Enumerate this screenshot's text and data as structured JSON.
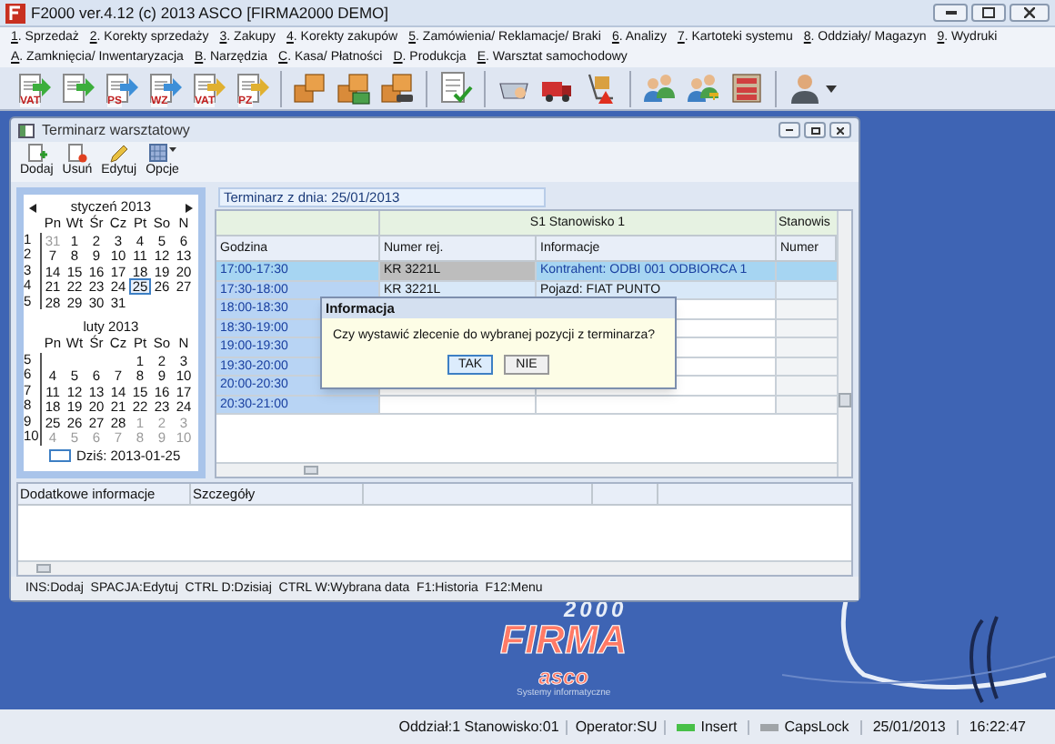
{
  "window": {
    "title": "F2000  ver.4.12 (c) 2013 ASCO  [FIRMA2000 DEMO]"
  },
  "menu": [
    {
      "items": [
        "1. Sprzedaż",
        "2. Korekty sprzedaży",
        "3. Zakupy",
        "4. Korekty zakupów",
        "5. Zamówienia/ Reklamacje/ Braki",
        "6. Analizy",
        "7. Kartoteki systemu",
        "8. Oddziały/ Magazyn",
        "9. Wydruki"
      ]
    },
    {
      "items": [
        "A. Zamknięcia/ Inwentaryzacja",
        "B. Narzędzia",
        "C. Kasa/ Płatności",
        "D. Produkcja",
        "E. Warsztat samochodowy"
      ]
    }
  ],
  "toolbar": [
    {
      "kind": "doc",
      "label": "VAT",
      "color": "#3cae3c"
    },
    {
      "kind": "doc",
      "color": "#3cae3c"
    },
    {
      "kind": "doc",
      "label": "PS",
      "color": "#3d8fd8"
    },
    {
      "kind": "doc",
      "label": "WZ",
      "color": "#3d8fd8"
    },
    {
      "kind": "doc",
      "label": "VAT",
      "color": "#e0b030"
    },
    {
      "kind": "doc",
      "label": "PZ",
      "color": "#e0b030"
    },
    {
      "kind": "separator"
    },
    {
      "kind": "boxes"
    },
    {
      "kind": "boxes-stack"
    },
    {
      "kind": "boxes-car"
    },
    {
      "kind": "separator"
    },
    {
      "kind": "check-doc"
    },
    {
      "kind": "separator"
    },
    {
      "kind": "basket"
    },
    {
      "kind": "truck"
    },
    {
      "kind": "cart"
    },
    {
      "kind": "separator"
    },
    {
      "kind": "people"
    },
    {
      "kind": "people-key"
    },
    {
      "kind": "shelves"
    },
    {
      "kind": "separator"
    },
    {
      "kind": "user"
    }
  ],
  "inner_window": {
    "title": "Terminarz warsztatowy",
    "toolbar": [
      {
        "kind": "add",
        "label": "Dodaj"
      },
      {
        "kind": "remove",
        "label": "Usuń"
      },
      {
        "kind": "edit",
        "label": "Edytuj"
      },
      {
        "kind": "options",
        "label": "Opcje"
      }
    ]
  },
  "calendar": {
    "months": [
      {
        "title": "styczeń 2013",
        "nav": true,
        "weekdays": [
          "Pn",
          "Wt",
          "Śr",
          "Cz",
          "Pt",
          "So",
          "N"
        ],
        "weeks": [
          {
            "number": "1",
            "days": [
              {
                "kind": "other",
                "day": "31",
                "selected": false
              },
              {
                "kind": "current",
                "day": "1",
                "selected": false
              },
              {
                "kind": "current",
                "day": "2",
                "selected": false
              },
              {
                "kind": "current",
                "day": "3",
                "selected": false
              },
              {
                "kind": "current",
                "day": "4",
                "selected": false
              },
              {
                "kind": "current",
                "day": "5",
                "selected": false
              },
              {
                "kind": "current",
                "day": "6",
                "selected": false
              }
            ]
          },
          {
            "number": "2",
            "days": [
              {
                "kind": "current",
                "day": "7",
                "selected": false
              },
              {
                "kind": "current",
                "day": "8",
                "selected": false
              },
              {
                "kind": "current",
                "day": "9",
                "selected": false
              },
              {
                "kind": "current",
                "day": "10",
                "selected": false
              },
              {
                "kind": "current",
                "day": "11",
                "selected": false
              },
              {
                "kind": "current",
                "day": "12",
                "selected": false
              },
              {
                "kind": "current",
                "day": "13",
                "selected": false
              }
            ]
          },
          {
            "number": "3",
            "days": [
              {
                "kind": "current",
                "day": "14",
                "selected": false
              },
              {
                "kind": "current",
                "day": "15",
                "selected": false
              },
              {
                "kind": "current",
                "day": "16",
                "selected": false
              },
              {
                "kind": "current",
                "day": "17",
                "selected": false
              },
              {
                "kind": "current",
                "day": "18",
                "selected": false
              },
              {
                "kind": "current",
                "day": "19",
                "selected": false
              },
              {
                "kind": "current",
                "day": "20",
                "selected": false
              }
            ]
          },
          {
            "number": "4",
            "days": [
              {
                "kind": "current",
                "day": "21",
                "selected": false
              },
              {
                "kind": "current",
                "day": "22",
                "selected": false
              },
              {
                "kind": "current",
                "day": "23",
                "selected": false
              },
              {
                "kind": "current",
                "day": "24",
                "selected": false
              },
              {
                "kind": "current",
                "day": "25",
                "selected": true
              },
              {
                "kind": "current",
                "day": "26",
                "selected": false
              },
              {
                "kind": "current",
                "day": "27",
                "selected": false
              }
            ]
          },
          {
            "number": "5",
            "days": [
              {
                "kind": "current",
                "day": "28",
                "selected": false
              },
              {
                "kind": "current",
                "day": "29",
                "selected": false
              },
              {
                "kind": "current",
                "day": "30",
                "selected": false
              },
              {
                "kind": "current",
                "day": "31",
                "selected": false
              }
            ]
          }
        ]
      },
      {
        "title": "luty 2013",
        "nav": false,
        "weekdays": [
          "Pn",
          "Wt",
          "Śr",
          "Cz",
          "Pt",
          "So",
          "N"
        ],
        "weeks": [
          {
            "number": "5",
            "days": [
              {
                "kind": "blank"
              },
              {
                "kind": "blank"
              },
              {
                "kind": "blank"
              },
              {
                "kind": "blank"
              },
              {
                "kind": "current",
                "day": "1",
                "selected": false
              },
              {
                "kind": "current",
                "day": "2",
                "selected": false
              },
              {
                "kind": "current",
                "day": "3",
                "selected": false
              }
            ]
          },
          {
            "number": "6",
            "days": [
              {
                "kind": "current",
                "day": "4",
                "selected": false
              },
              {
                "kind": "current",
                "day": "5",
                "selected": false
              },
              {
                "kind": "current",
                "day": "6",
                "selected": false
              },
              {
                "kind": "current",
                "day": "7",
                "selected": false
              },
              {
                "kind": "current",
                "day": "8",
                "selected": false
              },
              {
                "kind": "current",
                "day": "9",
                "selected": false
              },
              {
                "kind": "current",
                "day": "10",
                "selected": false
              }
            ]
          },
          {
            "number": "7",
            "days": [
              {
                "kind": "current",
                "day": "11",
                "selected": false
              },
              {
                "kind": "current",
                "day": "12",
                "selected": false
              },
              {
                "kind": "current",
                "day": "13",
                "selected": false
              },
              {
                "kind": "current",
                "day": "14",
                "selected": false
              },
              {
                "kind": "current",
                "day": "15",
                "selected": false
              },
              {
                "kind": "current",
                "day": "16",
                "selected": false
              },
              {
                "kind": "current",
                "day": "17",
                "selected": false
              }
            ]
          },
          {
            "number": "8",
            "days": [
              {
                "kind": "current",
                "day": "18",
                "selected": false
              },
              {
                "kind": "current",
                "day": "19",
                "selected": false
              },
              {
                "kind": "current",
                "day": "20",
                "selected": false
              },
              {
                "kind": "current",
                "day": "21",
                "selected": false
              },
              {
                "kind": "current",
                "day": "22",
                "selected": false
              },
              {
                "kind": "current",
                "day": "23",
                "selected": false
              },
              {
                "kind": "current",
                "day": "24",
                "selected": false
              }
            ]
          },
          {
            "number": "9",
            "days": [
              {
                "kind": "current",
                "day": "25",
                "selected": false
              },
              {
                "kind": "current",
                "day": "26",
                "selected": false
              },
              {
                "kind": "current",
                "day": "27",
                "selected": false
              },
              {
                "kind": "current",
                "day": "28",
                "selected": false
              },
              {
                "kind": "other",
                "day": "1",
                "selected": false
              },
              {
                "kind": "other",
                "day": "2",
                "selected": false
              },
              {
                "kind": "other",
                "day": "3",
                "selected": false
              }
            ]
          },
          {
            "number": "10",
            "days": [
              {
                "kind": "other",
                "day": "4",
                "selected": false
              },
              {
                "kind": "other",
                "day": "5",
                "selected": false
              },
              {
                "kind": "other",
                "day": "6",
                "selected": false
              },
              {
                "kind": "other",
                "day": "7",
                "selected": false
              },
              {
                "kind": "other",
                "day": "8",
                "selected": false
              },
              {
                "kind": "other",
                "day": "9",
                "selected": false
              },
              {
                "kind": "other",
                "day": "10",
                "selected": false
              }
            ]
          }
        ]
      }
    ],
    "today_label": "Dziś: 2013-01-25"
  },
  "schedule": {
    "heading": "Terminarz z dnia: 25/01/2013",
    "groups": [
      "S1 Stanowisko 1",
      "Stanowis"
    ],
    "columns": [
      "Godzina",
      "Numer rej.",
      "Informacje",
      "Numer"
    ],
    "rows": [
      {
        "time": "17:00-17:30",
        "plate": "KR 3221L",
        "info": "Kontrahent: ODBI 001 ODBIORCA 1",
        "selected": true,
        "booked": true
      },
      {
        "time": "17:30-18:00",
        "plate": "KR 3221L",
        "info": "Pojazd: FIAT PUNTO",
        "selected": false,
        "booked": true
      },
      {
        "time": "18:00-18:30",
        "selected": false,
        "booked": false
      },
      {
        "time": "18:30-19:00",
        "selected": false,
        "booked": false
      },
      {
        "time": "19:00-19:30",
        "selected": false,
        "booked": false
      },
      {
        "time": "19:30-20:00",
        "selected": false,
        "booked": false
      },
      {
        "time": "20:00-20:30",
        "selected": false,
        "booked": false
      },
      {
        "time": "20:30-21:00",
        "selected": false,
        "booked": false
      }
    ]
  },
  "dialog": {
    "title": "Informacja",
    "message": "Czy wystawić zlecenie do wybranej pozycji z terminarza?",
    "buttons": [
      {
        "label": "TAK",
        "focused": true
      },
      {
        "label": "NIE",
        "focused": false
      }
    ]
  },
  "details": {
    "columns": [
      "Dodatkowe informacje",
      "Szczegóły"
    ]
  },
  "hint_bar": "INS:Dodaj  SPACJA:Edytuj  CTRL D:Dzisiaj  CTRL W:Wybrana data  F1:Historia  F12:Menu",
  "logo": {
    "number": "2000",
    "word": "FIRMA",
    "brand": "asco",
    "tagline": "Systemy informatyczne"
  },
  "status_bar": {
    "branch": "Oddział:1 Stanowisko:01",
    "operator": "Operator:SU",
    "indicators": [
      {
        "label": "Insert",
        "on": true
      },
      {
        "label": "CapsLock",
        "on": false
      }
    ],
    "date": "25/01/2013",
    "time": "16:22:47"
  }
}
